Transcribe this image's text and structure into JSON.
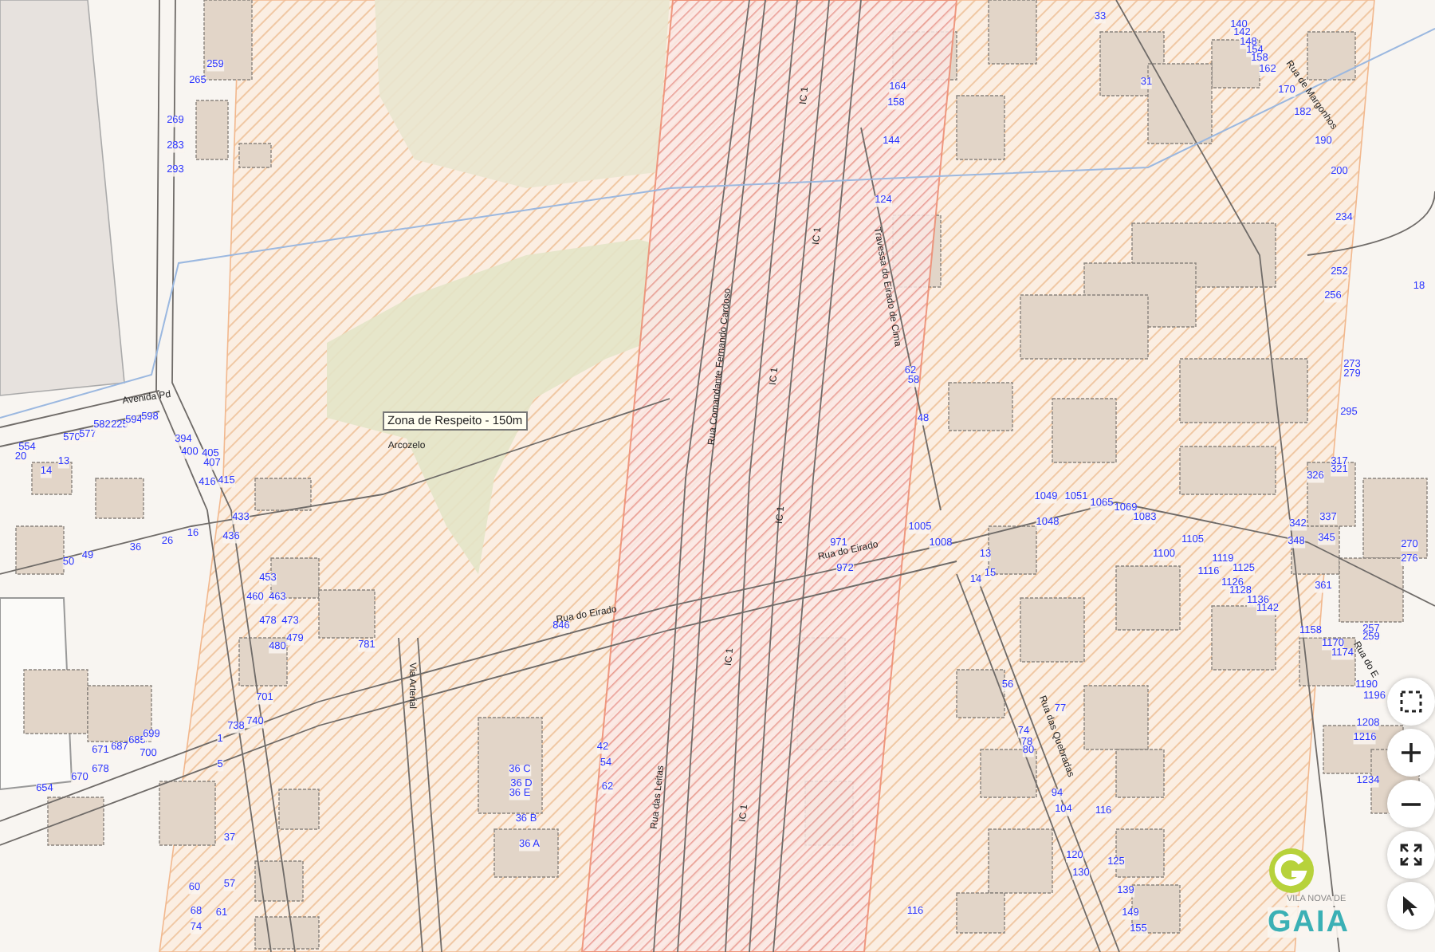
{
  "map": {
    "zone_label": "Zona de Respeito - 150m",
    "street_labels": [
      "Avenida Pd",
      "Arcozelo",
      "Rua Comandante Fernando Cardoso",
      "Travessa do Eirado de Cima",
      "IC 1",
      "IC 1",
      "IC 1",
      "IC 1",
      "IC 1",
      "IC 1",
      "Rua do Eirado",
      "Rua do Eirado",
      "Rua das Leitas",
      "Via Arterial",
      "Rua de Margonhos",
      "Rua das Quebradas",
      "Rua do E"
    ],
    "house_numbers": [
      "259",
      "265",
      "269",
      "283",
      "293",
      "570",
      "577",
      "582",
      "225",
      "594",
      "598",
      "394",
      "554",
      "20",
      "14",
      "13",
      "400",
      "405",
      "407",
      "416",
      "415",
      "433",
      "16",
      "26",
      "36",
      "49",
      "50",
      "436",
      "453",
      "460",
      "463",
      "478",
      "473",
      "479",
      "480",
      "781",
      "701",
      "738",
      "740",
      "671",
      "687",
      "685",
      "699",
      "700",
      "678",
      "670",
      "654",
      "1",
      "5",
      "37",
      "57",
      "60",
      "68",
      "61",
      "74",
      "164",
      "158",
      "144",
      "124",
      "62",
      "58",
      "48",
      "33",
      "140",
      "142",
      "148",
      "154",
      "158",
      "162",
      "31",
      "170",
      "182",
      "190",
      "200",
      "234",
      "252",
      "256",
      "18",
      "273",
      "279",
      "295",
      "317",
      "321",
      "326",
      "1049",
      "1051",
      "1065",
      "1069",
      "1083",
      "1048",
      "342",
      "337",
      "348",
      "345",
      "270",
      "276",
      "1105",
      "1100",
      "1119",
      "1116",
      "1125",
      "1126",
      "1128",
      "1136",
      "1142",
      "13",
      "15",
      "14",
      "1158",
      "361",
      "1170",
      "1174",
      "257",
      "259",
      "1190",
      "1196",
      "1208",
      "1216",
      "1234",
      "56",
      "77",
      "74",
      "78",
      "80",
      "94",
      "104",
      "116",
      "120",
      "125",
      "130",
      "139",
      "149",
      "155",
      "1005",
      "971",
      "1008",
      "972",
      "846",
      "42",
      "54",
      "62",
      "36 C",
      "36 D",
      "36 E",
      "36 B",
      "36 A",
      "116"
    ]
  },
  "controls": [
    {
      "kind": "box-select"
    },
    {
      "kind": "zoom-in"
    },
    {
      "kind": "zoom-out"
    },
    {
      "kind": "fullscreen"
    },
    {
      "kind": "pointer"
    }
  ],
  "logo": {
    "subtitle": "VILA NOVA DE",
    "wordmark": "GAIA"
  }
}
